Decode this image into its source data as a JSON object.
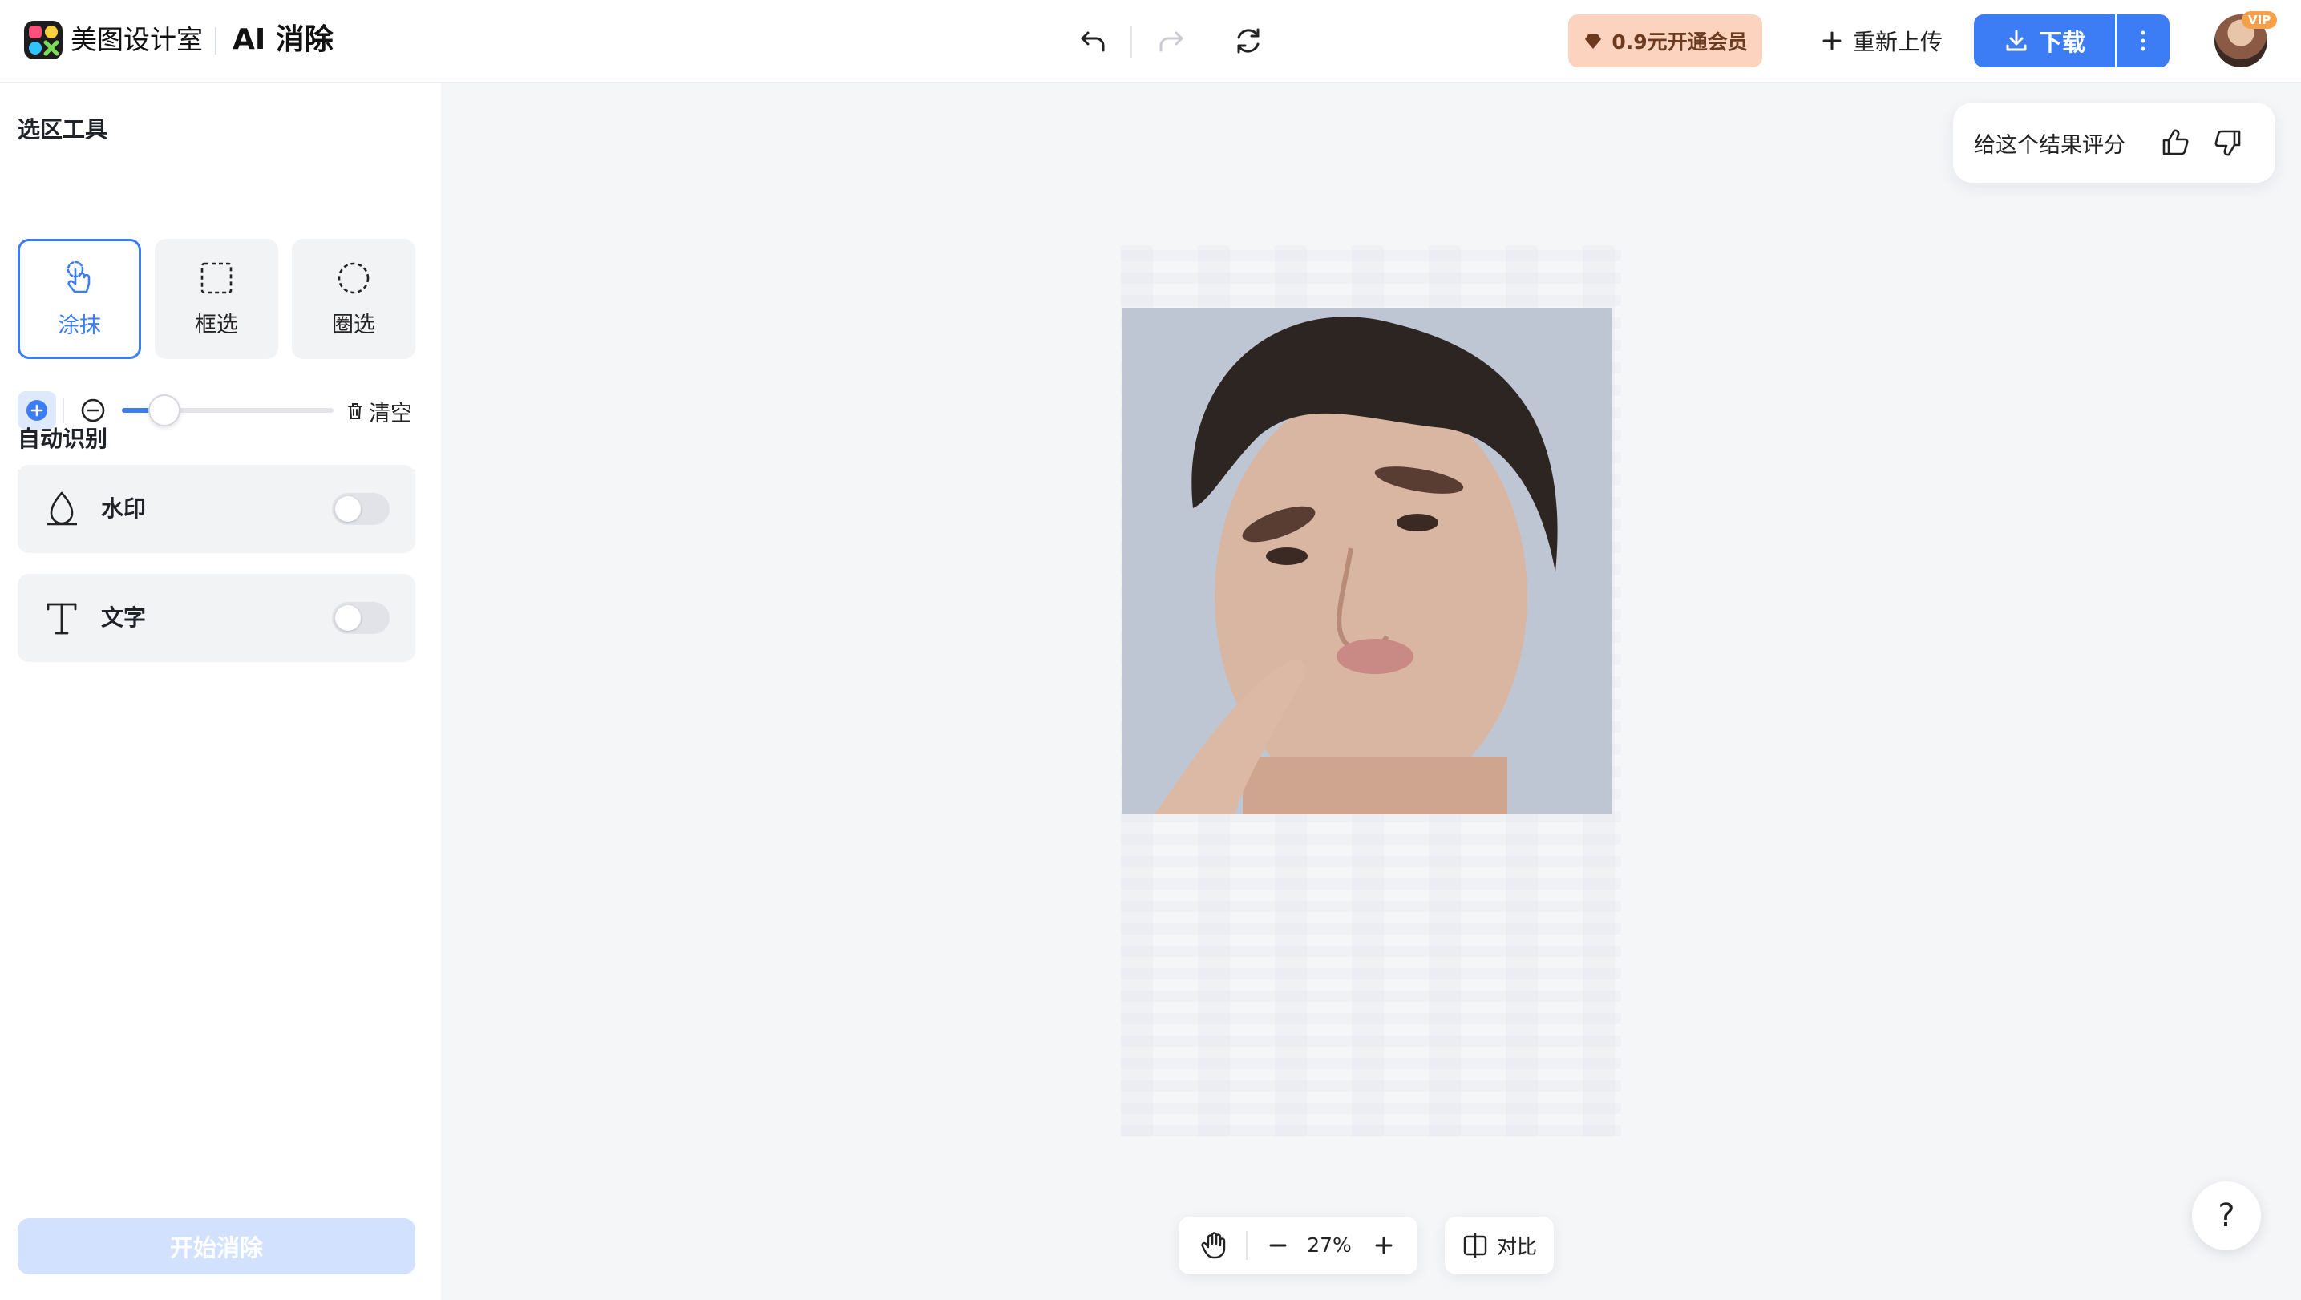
{
  "header": {
    "brand": "美图设计室",
    "product": "AI 消除",
    "vip_label": "0.9元开通会员",
    "reupload_label": "重新上传",
    "download_label": "下载",
    "avatar_badge": "VIP"
  },
  "sidebar": {
    "section_tools": "选区工具",
    "tools": [
      {
        "label": "涂抹",
        "icon": "hand-pointer-icon",
        "active": true
      },
      {
        "label": "框选",
        "icon": "rect-select-icon",
        "active": false
      },
      {
        "label": "圈选",
        "icon": "lasso-select-icon",
        "active": false
      }
    ],
    "brush_size_level": 0.2,
    "clear_label": "清空",
    "section_auto": "自动识别",
    "auto_items": [
      {
        "label": "水印",
        "icon": "watermark-icon",
        "enabled": false
      },
      {
        "label": "文字",
        "icon": "text-icon",
        "enabled": false
      }
    ],
    "start_label": "开始消除"
  },
  "canvas": {
    "rating_prompt": "给这个结果评分",
    "zoom_level": "27%",
    "compare_label": "对比",
    "help_label": "?"
  },
  "colors": {
    "accent": "#3c7cf5",
    "vip_bg": "#fbd3bf",
    "start_disabled": "#d2e1fd"
  }
}
